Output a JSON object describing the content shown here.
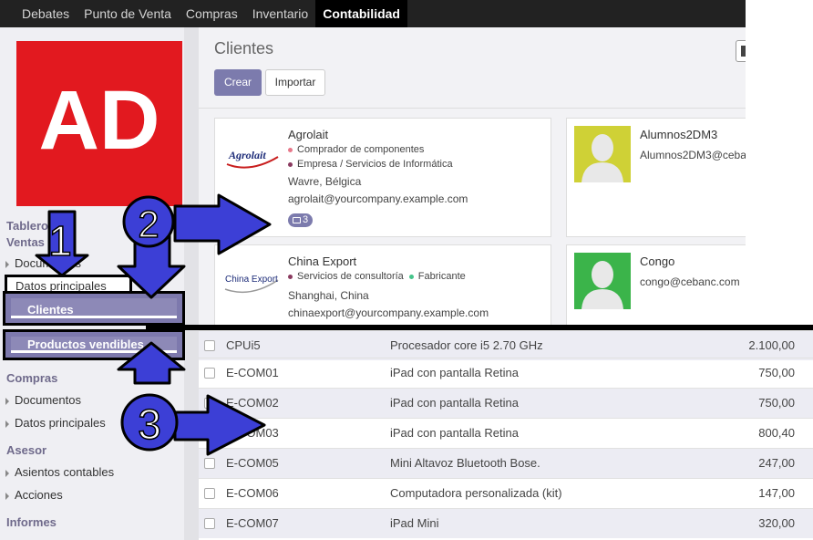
{
  "topbar": {
    "items": [
      "Debates",
      "Punto de Venta",
      "Compras",
      "Inventario",
      "Contabilidad"
    ],
    "active_index": 4
  },
  "logo": {
    "text": "AD"
  },
  "sidebar": {
    "sections": {
      "tablero": "Tablero",
      "ventas": "Ventas",
      "compras": "Compras",
      "asesor": "Asesor",
      "informes": "Informes"
    },
    "items": {
      "documentos_ventas": "Documentos",
      "datos_principales_ventas": "Datos principales",
      "clientes": "Clientes",
      "productos_vendibles": "Productos vendibles",
      "documentos_compras": "Documentos",
      "datos_principales_compras": "Datos principales",
      "asientos_contables": "Asientos contables",
      "acciones": "Acciones"
    }
  },
  "main": {
    "title": "Clientes",
    "crear_label": "Crear",
    "importar_label": "Importar"
  },
  "cards": [
    {
      "name": "Agrolait",
      "logo_text": "Agrolait",
      "tags": [
        {
          "label": "Comprador de componentes",
          "color": "#e7788a"
        },
        {
          "label": "Empresa / Servicios de Informática",
          "color": "#8a3a5f"
        }
      ],
      "location": "Wavre, Bélgica",
      "email": "agrolait@yourcompany.example.com",
      "badge": "3"
    },
    {
      "name": "Alumnos2DM3",
      "email": "Alumnos2DM3@ceba",
      "avatar_color": "#cfd136"
    },
    {
      "name": "China Export",
      "logo_text": "China Export",
      "tags": [
        {
          "label": "Servicios de consultoría",
          "color": "#8a3a5f"
        },
        {
          "label": "Fabricante",
          "color": "#45c48a"
        }
      ],
      "location": "Shanghai, China",
      "email": "chinaexport@yourcompany.example.com"
    },
    {
      "name": "Congo",
      "email": "congo@cebanc.com",
      "avatar_color": "#3bb44a"
    }
  ],
  "products": [
    {
      "code": "CPUi5",
      "desc": "Procesador core i5 2.70 GHz",
      "price": "2.100,00"
    },
    {
      "code": "E-COM01",
      "desc": "iPad con pantalla Retina",
      "price": "750,00"
    },
    {
      "code": "E-COM02",
      "desc": "iPad con pantalla Retina",
      "price": "750,00"
    },
    {
      "code": "E-COM03",
      "desc": "iPad con pantalla Retina",
      "price": "800,40"
    },
    {
      "code": "E-COM05",
      "desc": "Mini Altavoz Bluetooth Bose.",
      "price": "247,00"
    },
    {
      "code": "E-COM06",
      "desc": "Computadora personalizada (kit)",
      "price": "147,00"
    },
    {
      "code": "E-COM07",
      "desc": "iPad Mini",
      "price": "320,00"
    }
  ],
  "annotations": {
    "step1": "1",
    "step2": "2",
    "step3": "3"
  },
  "colors": {
    "accent": "#7c7bad",
    "arrow": "#3c3fd6",
    "logo_red": "#e2191f"
  }
}
